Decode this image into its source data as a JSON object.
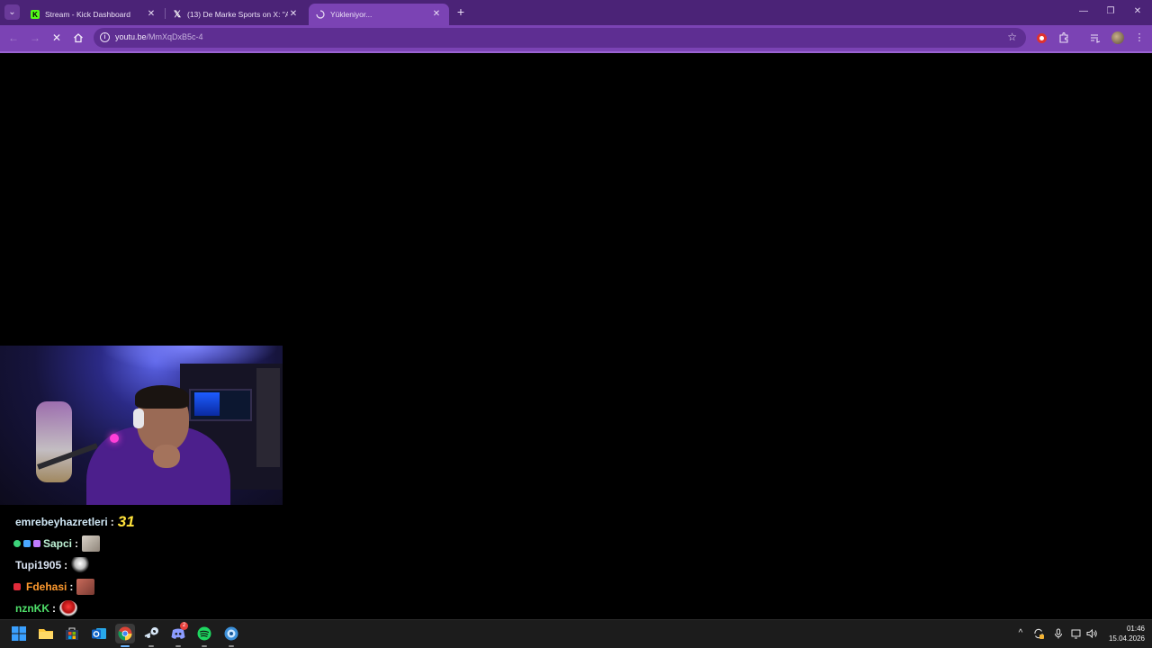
{
  "browser": {
    "tabs": [
      {
        "title": "Stream - Kick Dashboard",
        "favicon": "kick-logo-icon"
      },
      {
        "title": "(13) De Marke Sports on X: \"Ar",
        "favicon": "x-logo-icon"
      },
      {
        "title": "Yükleniyor...",
        "favicon": "loading-spinner-icon",
        "active": true
      }
    ],
    "address": {
      "domain": "youtu.be",
      "path": "/MmXqDxB5c-4"
    },
    "accent_color": "#7b43b4",
    "tabstrip_color": "#4b2377"
  },
  "chat": {
    "messages": [
      {
        "user": "emrebeyhazretleri",
        "color": "#cfe7f5",
        "text": "31",
        "badges": []
      },
      {
        "user": "Sapci",
        "color": "#bff3d6",
        "emote": "emote-icon",
        "badges": [
          "verified-badge-icon",
          "gift-badge-icon",
          "sub-badge-icon"
        ]
      },
      {
        "user": "Tupi1905",
        "color": "#d9e3f2",
        "emote": "emote-icon",
        "badges": []
      },
      {
        "user": "Fdehasi",
        "color": "#ff9a2e",
        "emote": "emote-icon",
        "badges": [
          "sub-badge-icon"
        ]
      },
      {
        "user": "nznKK",
        "color": "#4fe06a",
        "emote": "emote-icon",
        "badges": []
      }
    ]
  },
  "taskbar": {
    "apps": [
      "start-icon",
      "file-explorer-icon",
      "microsoft-store-icon",
      "outlook-icon",
      "chrome-icon",
      "steam-icon",
      "discord-icon",
      "spotify-icon",
      "custom-app-icon"
    ],
    "active_app": "chrome-icon",
    "discord_badge": "2",
    "time": "01:46",
    "date": "15.04.2026"
  }
}
